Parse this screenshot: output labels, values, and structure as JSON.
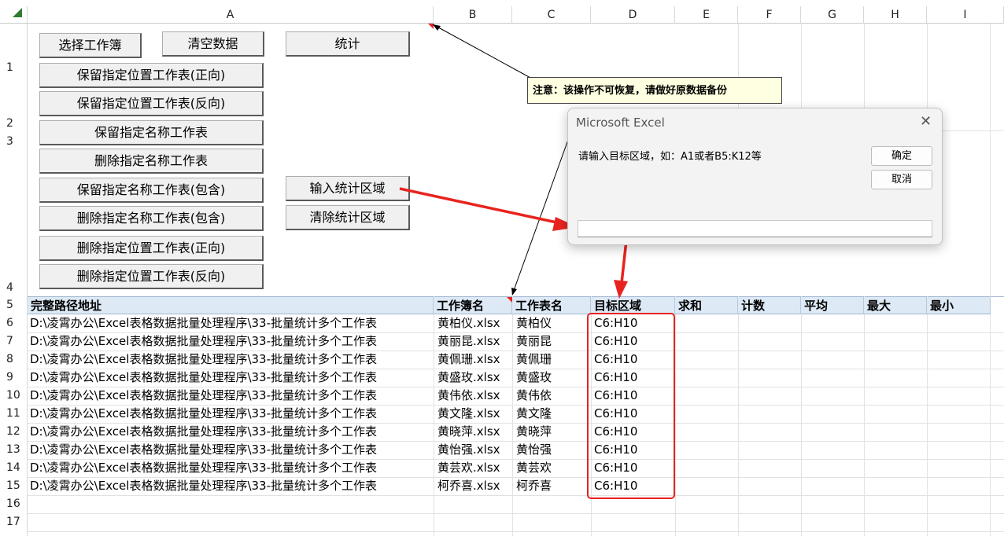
{
  "columns": [
    "A",
    "B",
    "C",
    "D",
    "E",
    "F",
    "G",
    "H",
    "I"
  ],
  "rows": [
    "1",
    "2",
    "3",
    "4",
    "5",
    "6",
    "7",
    "8",
    "9",
    "10",
    "11",
    "12",
    "13",
    "14",
    "15",
    "16",
    "17"
  ],
  "buttons": {
    "select_workbook": "选择工作簿",
    "clear_data": "清空数据",
    "stats": "统计",
    "keep_pos_fwd": "保留指定位置工作表(正向)",
    "keep_pos_rev": "保留指定位置工作表(反向)",
    "keep_name": "保留指定名称工作表",
    "delete_name": "删除指定名称工作表",
    "keep_name_contains": "保留指定名称工作表(包含)",
    "delete_name_contains": "删除指定名称工作表(包含)",
    "delete_pos_fwd": "删除指定位置工作表(正向)",
    "delete_pos_rev": "删除指定位置工作表(反向)",
    "input_range": "输入统计区域",
    "clear_range": "清除统计区域"
  },
  "note": "注意：该操作不可恢复，请做好原数据备份",
  "dialog": {
    "title": "Microsoft Excel",
    "close": "✕",
    "prompt": "请输入目标区域，如：A1或者B5:K12等",
    "ok": "确定",
    "cancel": "取消",
    "value": ""
  },
  "table": {
    "headers": [
      "完整路径地址",
      "工作簿名",
      "工作表名",
      "目标区域",
      "求和",
      "计数",
      "平均",
      "最大",
      "最小"
    ],
    "rows": [
      [
        "D:\\凌霄办公\\Excel表格数据批量处理程序\\33-批量统计多个工作表",
        "黄柏仪.xlsx",
        "黄柏仪",
        "C6:H10"
      ],
      [
        "D:\\凌霄办公\\Excel表格数据批量处理程序\\33-批量统计多个工作表",
        "黄丽昆.xlsx",
        "黄丽昆",
        "C6:H10"
      ],
      [
        "D:\\凌霄办公\\Excel表格数据批量处理程序\\33-批量统计多个工作表",
        "黄佩珊.xlsx",
        "黄佩珊",
        "C6:H10"
      ],
      [
        "D:\\凌霄办公\\Excel表格数据批量处理程序\\33-批量统计多个工作表",
        "黄盛玫.xlsx",
        "黄盛玫",
        "C6:H10"
      ],
      [
        "D:\\凌霄办公\\Excel表格数据批量处理程序\\33-批量统计多个工作表",
        "黄伟依.xlsx",
        "黄伟依",
        "C6:H10"
      ],
      [
        "D:\\凌霄办公\\Excel表格数据批量处理程序\\33-批量统计多个工作表",
        "黄文隆.xlsx",
        "黄文隆",
        "C6:H10"
      ],
      [
        "D:\\凌霄办公\\Excel表格数据批量处理程序\\33-批量统计多个工作表",
        "黄晓萍.xlsx",
        "黄晓萍",
        "C6:H10"
      ],
      [
        "D:\\凌霄办公\\Excel表格数据批量处理程序\\33-批量统计多个工作表",
        "黄怡强.xlsx",
        "黄怡强",
        "C6:H10"
      ],
      [
        "D:\\凌霄办公\\Excel表格数据批量处理程序\\33-批量统计多个工作表",
        "黄芸欢.xlsx",
        "黄芸欢",
        "C6:H10"
      ],
      [
        "D:\\凌霄办公\\Excel表格数据批量处理程序\\33-批量统计多个工作表",
        "柯乔喜.xlsx",
        "柯乔喜",
        "C6:H10"
      ]
    ]
  },
  "colors": {
    "header_fill": "#dde9f5",
    "highlight": "#e8231e",
    "note_fill": "#ffffe1",
    "sheet_corner": "#2e7d32"
  }
}
